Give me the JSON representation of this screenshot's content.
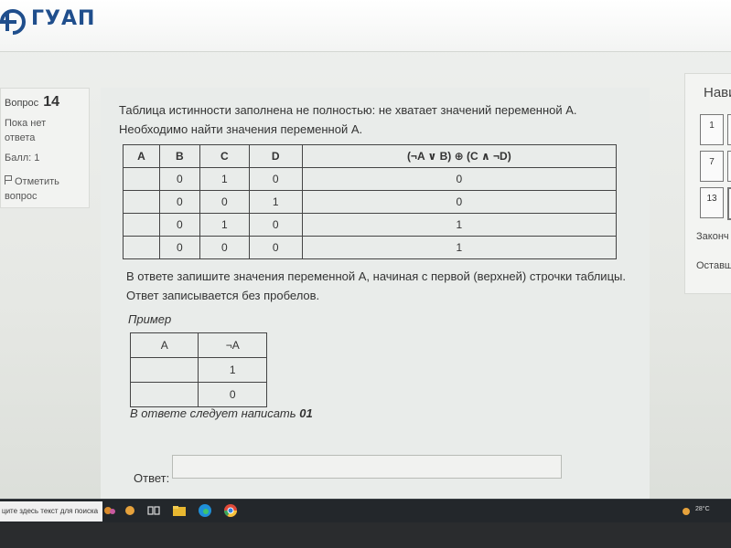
{
  "brand": {
    "logo_text": "ГУАП"
  },
  "question_info": {
    "prefix": "Вопрос",
    "number": "14",
    "status_line1": "Пока нет",
    "status_line2": "ответа",
    "score": "Балл: 1",
    "flag_line1": "Отметить",
    "flag_line2": "вопрос",
    "flag_icon": "flag-icon"
  },
  "question": {
    "text_line1": "Таблица истинности заполнена не полностью: не хватает значений переменной A.",
    "text_line2": "Необходимо найти значения переменной A.",
    "truth_table": {
      "headers": [
        "A",
        "B",
        "C",
        "D",
        "(¬A ∨ B) ⊕ (C ∧ ¬D)"
      ],
      "rows": [
        [
          "",
          "0",
          "1",
          "0",
          "0"
        ],
        [
          "",
          "0",
          "0",
          "1",
          "0"
        ],
        [
          "",
          "0",
          "1",
          "0",
          "1"
        ],
        [
          "",
          "0",
          "0",
          "0",
          "1"
        ]
      ]
    },
    "instruction_line1": "В ответе запишите значения переменной A, начиная с первой (верхней) строчки таблицы.",
    "instruction_line2": "Ответ записывается без пробелов.",
    "example_label": "Пример",
    "example_table": {
      "headers": [
        "A",
        "¬A"
      ],
      "rows": [
        [
          "",
          "1"
        ],
        [
          "",
          "0"
        ]
      ]
    },
    "example_answer_text": "В ответе следует написать",
    "example_answer_value": "01",
    "answer_label": "Ответ:",
    "answer_value": ""
  },
  "navigation": {
    "title": "Нави",
    "buttons": [
      "1",
      "7",
      "13"
    ],
    "finish_link": "Законч",
    "remaining_link": "Оставш"
  },
  "taskbar": {
    "search_placeholder": "ците здесь текст для поиска",
    "temperature": "28°C"
  }
}
